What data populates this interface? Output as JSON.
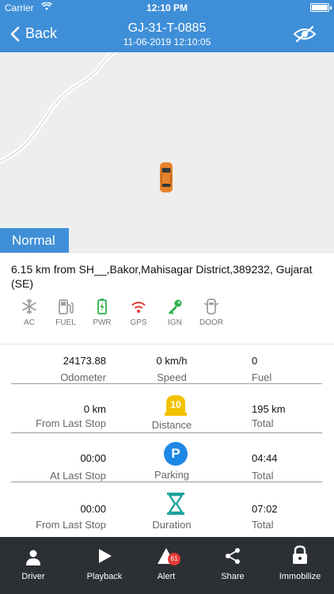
{
  "status": {
    "carrier": "Carrier",
    "time": "12:10 PM"
  },
  "nav": {
    "back_label": "Back",
    "title": "GJ-31-T-0885",
    "subtitle": "11-06-2019 12:10:05"
  },
  "mode_label": "Normal",
  "address": "6.15 km from SH__,Bakor,Mahisagar District,389232, Gujarat (SE)",
  "indicators": [
    {
      "label": "AC",
      "icon": "snowflake-icon",
      "color": "#9e9e9e"
    },
    {
      "label": "FUEL",
      "icon": "fuel-pump-icon",
      "color": "#9e9e9e"
    },
    {
      "label": "PWR",
      "icon": "battery-icon",
      "color": "#2bb24c"
    },
    {
      "label": "GPS",
      "icon": "signal-icon",
      "color": "#e53935"
    },
    {
      "label": "IGN",
      "icon": "key-icon",
      "color": "#2bb24c"
    },
    {
      "label": "DOOR",
      "icon": "car-door-icon",
      "color": "#9e9e9e"
    }
  ],
  "stats": {
    "row1": {
      "odometer_value": "24173.88",
      "odometer_label": "Odometer",
      "speed_value": "0 km/h",
      "speed_label": "Speed",
      "fuel_value": "0",
      "fuel_label": "Fuel"
    },
    "row2": {
      "left_value": "0 km",
      "left_label": "From Last Stop",
      "center_badge": "10",
      "center_label": "Distance",
      "right_value": "195 km",
      "right_label": "Total"
    },
    "row3": {
      "left_value": "00:00",
      "left_label": "At Last Stop",
      "center_badge": "P",
      "center_label": "Parking",
      "right_value": "04:44",
      "right_label": "Total"
    },
    "row4": {
      "left_value": "00:00",
      "left_label": "From Last Stop",
      "center_label": "Duration",
      "right_value": "07:02",
      "right_label": "Total"
    }
  },
  "tabs": [
    {
      "label": "Driver"
    },
    {
      "label": "Playback"
    },
    {
      "label": "Alert",
      "badge": "61"
    },
    {
      "label": "Share"
    },
    {
      "label": "Immobilize"
    }
  ],
  "colors": {
    "primary": "#3f8fd8",
    "tabbar": "#2c2f33",
    "vehicle": "#e8822a"
  }
}
